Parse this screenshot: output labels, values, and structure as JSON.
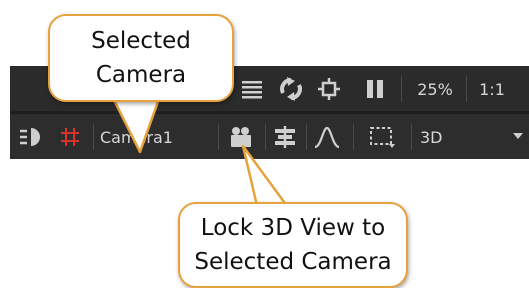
{
  "callouts": {
    "selected_camera": {
      "line1": "Selected",
      "line2": "Camera"
    },
    "lock_view": {
      "line1": "Lock 3D View to",
      "line2": "Selected Camera"
    }
  },
  "toolbar_top": {
    "zoom_label": "25%",
    "ratio_label": "1:1",
    "icons": [
      "list-icon",
      "sync-icon",
      "crosshair-icon",
      "pause-icon"
    ]
  },
  "toolbar_bottom": {
    "camera_label": "Camera1",
    "view_mode_label": "3D",
    "icons": [
      "light-icon",
      "grid-icon",
      "camera-lock-icon",
      "align-icon",
      "curve-icon",
      "selection-marquee-icon",
      "dropdown-arrow-icon"
    ]
  },
  "colors": {
    "toolbar_bg": "#2b2b2b",
    "accent_red": "#d9322b",
    "callout_border": "#e6a23c"
  }
}
